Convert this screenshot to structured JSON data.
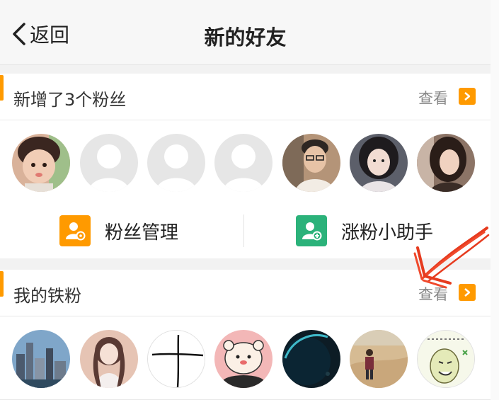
{
  "navbar": {
    "back_label": "返回",
    "title": "新的好友"
  },
  "fans": {
    "title": "新增了3个粉丝",
    "view_label": "查看",
    "avatars": [
      {
        "name": "avatar-child",
        "kind": "photo",
        "bg": "#d9b29a"
      },
      {
        "name": "avatar-default",
        "kind": "default"
      },
      {
        "name": "avatar-default",
        "kind": "default"
      },
      {
        "name": "avatar-default",
        "kind": "default"
      },
      {
        "name": "avatar-man-glasses",
        "kind": "photo",
        "bg": "#b49478"
      },
      {
        "name": "avatar-woman-1",
        "kind": "photo",
        "bg": "#5c5f6a"
      },
      {
        "name": "avatar-woman-2",
        "kind": "photo",
        "bg": "#8c7466"
      }
    ]
  },
  "actions": {
    "fan_management_label": "粉丝管理",
    "growth_helper_label": "涨粉小助手"
  },
  "iron_fans": {
    "title": "我的铁粉",
    "view_label": "查看",
    "avatars": [
      {
        "name": "avatar-city",
        "bg": "#7fa6c9"
      },
      {
        "name": "avatar-anime-girl",
        "bg": "#e6c4b4"
      },
      {
        "name": "avatar-sketch-cross",
        "bg": "#ffffff"
      },
      {
        "name": "avatar-cartoon-bear",
        "bg": "#f3b7b7"
      },
      {
        "name": "avatar-planet",
        "bg": "#0d1c25"
      },
      {
        "name": "avatar-man-field",
        "bg": "#c9a77b"
      },
      {
        "name": "avatar-meme-face",
        "bg": "#eaf0cf"
      }
    ]
  },
  "colors": {
    "accent": "#ff9a00",
    "green": "#2bb27a"
  }
}
